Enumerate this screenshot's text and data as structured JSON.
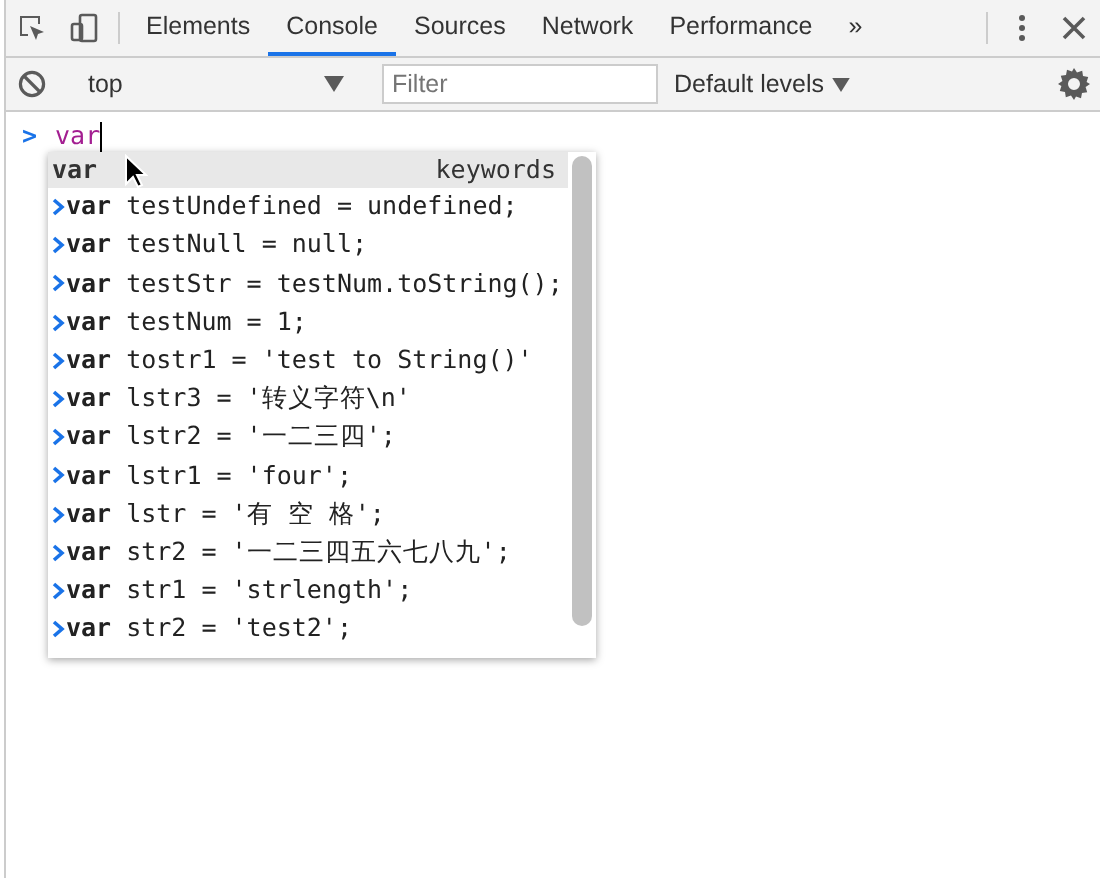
{
  "tabs": [
    {
      "label": "Elements",
      "selected": false
    },
    {
      "label": "Console",
      "selected": true
    },
    {
      "label": "Sources",
      "selected": false
    },
    {
      "label": "Network",
      "selected": false
    },
    {
      "label": "Performance",
      "selected": false
    }
  ],
  "overflow": "»",
  "context": {
    "value": "top"
  },
  "filter": {
    "placeholder": "Filter"
  },
  "levels": {
    "label": "Default levels"
  },
  "prompt": {
    "symbol": ">",
    "input": "var"
  },
  "autocomplete": {
    "header": {
      "text": "var",
      "category": "keywords"
    },
    "items": [
      {
        "text": "**var** testUndefined = undefined;"
      },
      {
        "text": "**var** testNull = null;"
      },
      {
        "text": "**var** testStr = testNum.toString();"
      },
      {
        "text": "**var** testNum = 1;"
      },
      {
        "text": "**var** tostr1 = 'test to String()'"
      },
      {
        "text": "**var** lstr3 = '转义字符\\n'"
      },
      {
        "text": "**var** lstr2 = '一二三四';"
      },
      {
        "text": "**var** lstr1 = 'four';"
      },
      {
        "text": "**var** lstr = '有 空 格';"
      },
      {
        "text": "**var** str2 = '一二三四五六七八九';"
      },
      {
        "text": "**var** str1 = 'strlength';"
      },
      {
        "text": "**var** str2 = 'test2';"
      }
    ]
  }
}
